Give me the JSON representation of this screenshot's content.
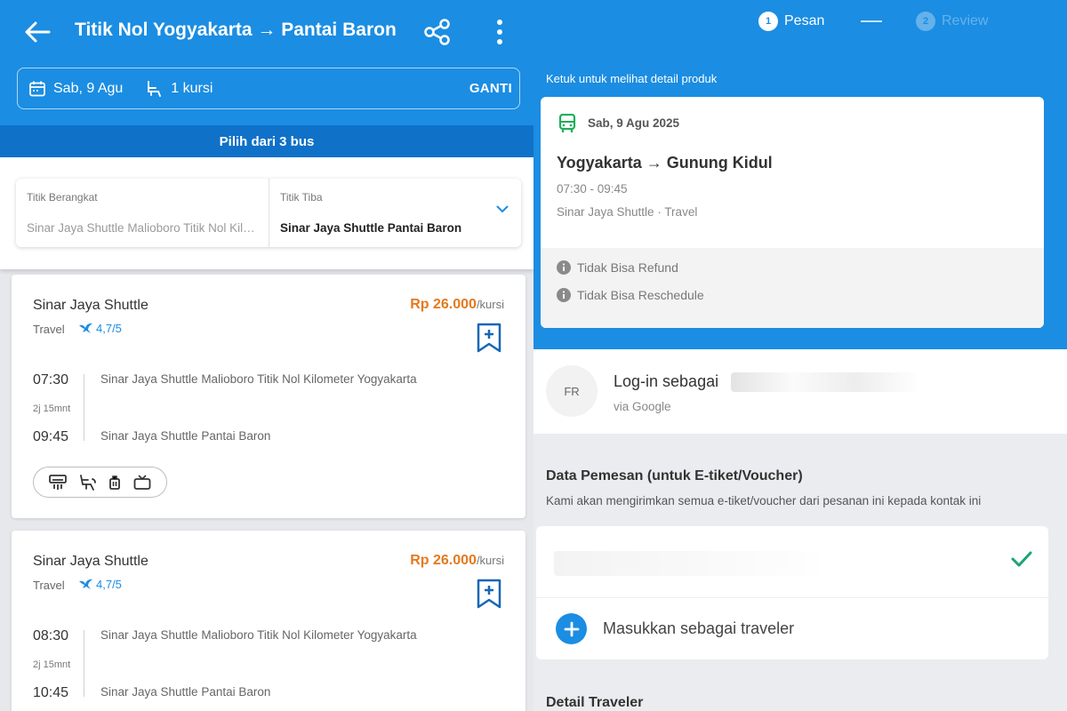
{
  "left": {
    "header": {
      "title": "Titik Nol Yogyakarta → Pantai Baron",
      "search": {
        "date": "Sab, 9 Agu",
        "seats": "1 kursi",
        "change_label": "GANTI"
      }
    },
    "choose_label": "Pilih dari 3 bus",
    "filter": {
      "departure_label": "Titik Berangkat",
      "departure_value": "Sinar Jaya Shuttle Malioboro Titik Nol Kilometer Yogyakarta",
      "arrival_label": "Titik Tiba",
      "arrival_value": "Sinar Jaya Shuttle Pantai Baron"
    },
    "buses": [
      {
        "operator": "Sinar Jaya Shuttle",
        "type": "Travel",
        "rating": "4,7/5",
        "price": "Rp 26.000",
        "price_unit": "/kursi",
        "dep_time": "07:30",
        "duration": "2j 15mnt",
        "arr_time": "09:45",
        "dep_location": "Sinar Jaya Shuttle Malioboro Titik Nol Kilometer Yogyakarta",
        "arr_location": "Sinar Jaya Shuttle Pantai Baron"
      },
      {
        "operator": "Sinar Jaya Shuttle",
        "type": "Travel",
        "rating": "4,7/5",
        "price": "Rp 26.000",
        "price_unit": "/kursi",
        "dep_time": "08:30",
        "duration": "2j 15mnt",
        "arr_time": "10:45",
        "dep_location": "Sinar Jaya Shuttle Malioboro Titik Nol Kilometer Yogyakarta",
        "arr_location": "Sinar Jaya Shuttle Pantai Baron"
      }
    ],
    "amenity_icons": [
      "ac-icon",
      "reclining-seat-icon",
      "luggage-icon",
      "tv-icon"
    ]
  },
  "right": {
    "steps": [
      {
        "number": "1",
        "label": "Pesan"
      },
      {
        "number": "2",
        "label": "Review"
      }
    ],
    "tap_hint": "Ketuk untuk melihat detail produk",
    "product": {
      "date": "Sab, 9 Agu 2025",
      "route": "Yogyakarta → Gunung Kidul",
      "time": "07:30 - 09:45",
      "operator": "Sinar Jaya Shuttle · Travel",
      "policies": [
        "Tidak Bisa Refund",
        "Tidak Bisa Reschedule"
      ]
    },
    "login": {
      "avatar_initials": "FR",
      "text": "Log-in sebagai",
      "via": "via Google"
    },
    "booking": {
      "title": "Data Pemesan (untuk E-tiket/Voucher)",
      "description": "Kami akan mengirimkan semua e-tiket/voucher dari pesanan ini kepada kontak ini",
      "add_traveler": "Masukkan sebagai traveler"
    },
    "traveler_title": "Detail Traveler"
  },
  "colors": {
    "primary": "#1b8de2",
    "primary_dark": "#0f71c8",
    "price": "#e5791d",
    "check": "#1aa377",
    "bus_icon": "#1fae58"
  }
}
